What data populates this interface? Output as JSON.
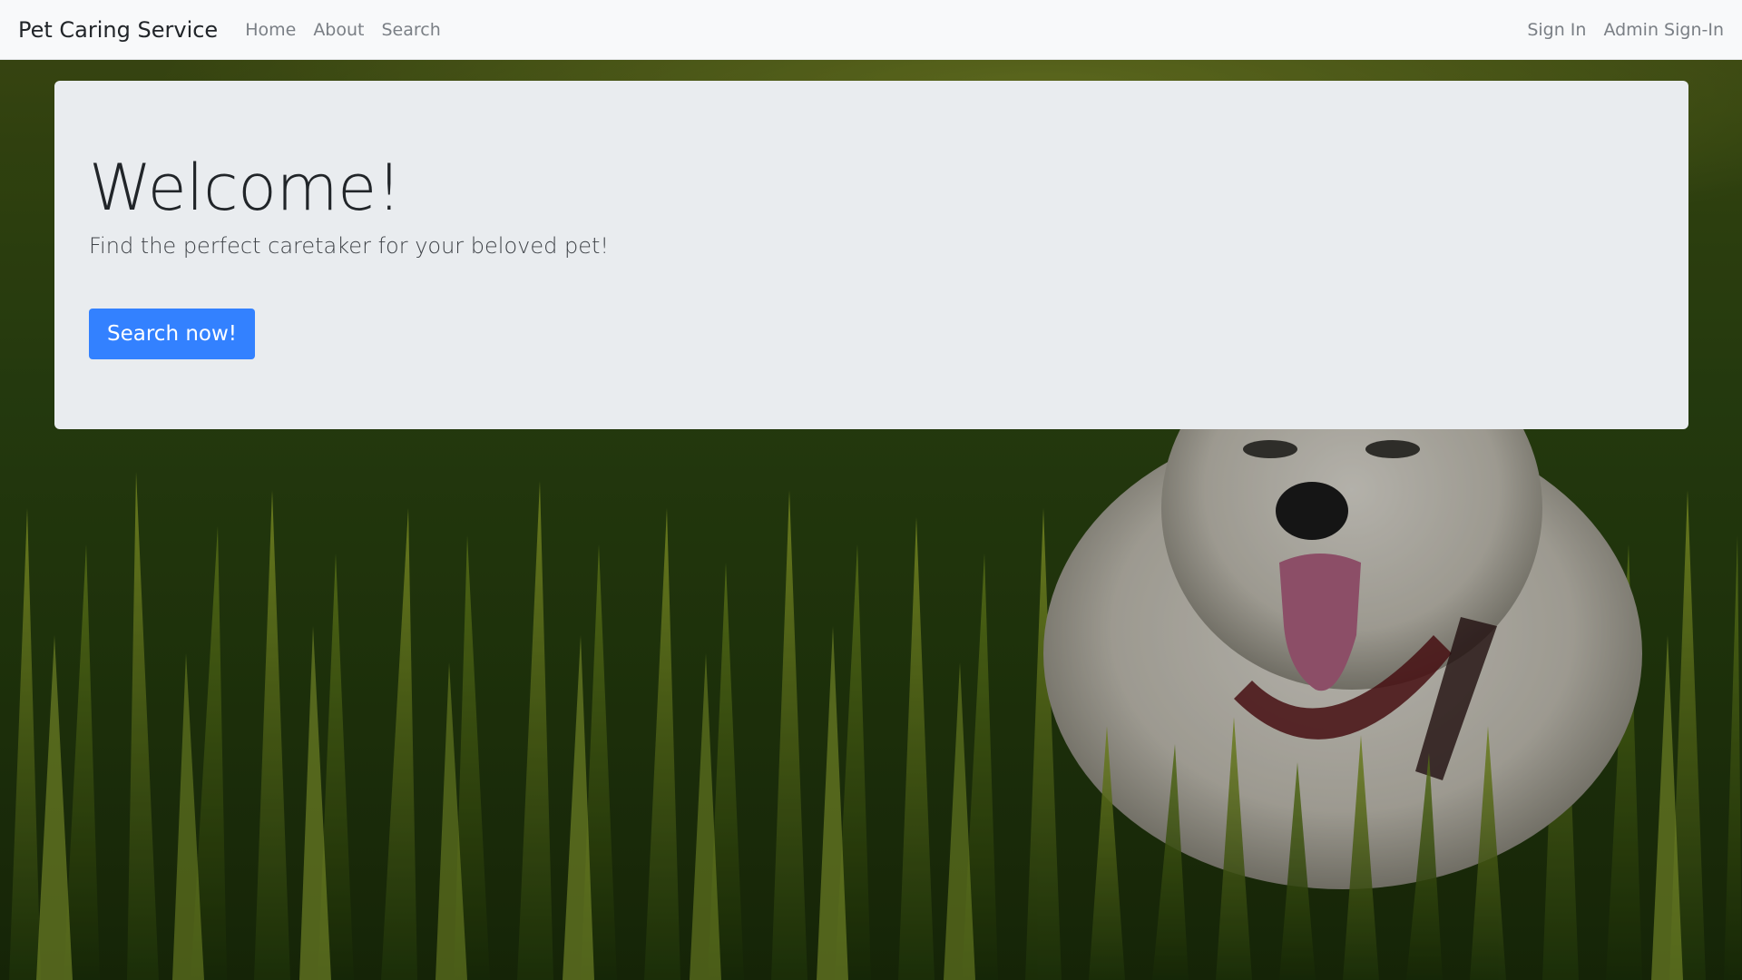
{
  "navbar": {
    "brand": "Pet Caring Service",
    "links": [
      {
        "label": "Home"
      },
      {
        "label": "About"
      },
      {
        "label": "Search"
      }
    ],
    "right_links": [
      {
        "label": "Sign In"
      },
      {
        "label": "Admin Sign-In"
      }
    ]
  },
  "hero": {
    "title": "Welcome!",
    "subtitle": "Find the perfect caretaker for your beloved pet!",
    "cta_label": "Search now!"
  },
  "colors": {
    "navbar_bg": "#f8f9fa",
    "jumbotron_bg": "#e9ecef",
    "primary_button": "#3381ff"
  }
}
